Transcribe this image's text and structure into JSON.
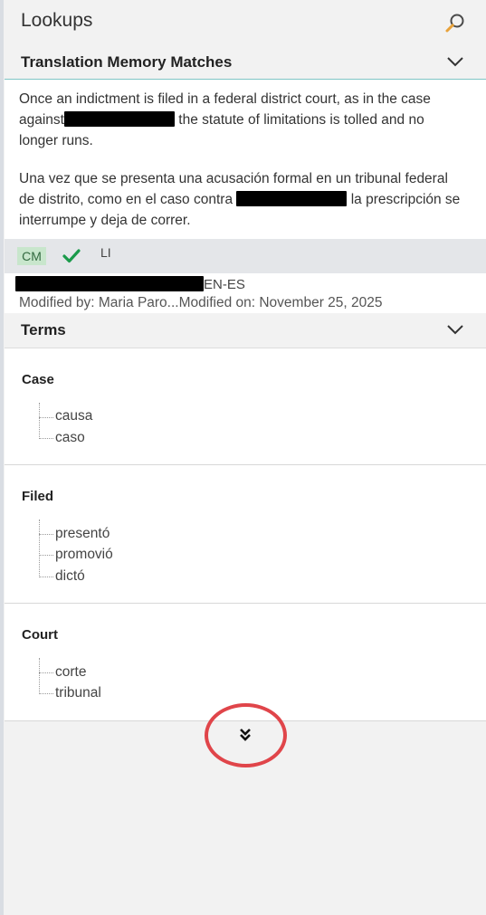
{
  "panel": {
    "title": "Lookups",
    "search_icon": "search-icon"
  },
  "tm": {
    "title": "Translation Memory Matches",
    "source_before": "Once an indictment is filed in a federal district court, as in the case against",
    "source_after": " the statute of limitations is tolled and no longer runs.",
    "target_before": "Una vez que se presenta una acusación formal en un tribunal federal de distrito, como en el caso contra",
    "target_after": " la prescripción se interrumpe y deja de correr.",
    "badge": "CM",
    "li_label": "LI",
    "lang_pair": "EN-ES",
    "modified_by": "Modified by: Maria Paro...",
    "modified_on": "Modified on: November 25, 2025"
  },
  "terms": {
    "title": "Terms",
    "groups": [
      {
        "head": "Case",
        "items": [
          "causa",
          "caso"
        ]
      },
      {
        "head": "Filed",
        "items": [
          "presentó",
          "promovió",
          "dictó"
        ]
      },
      {
        "head": "Court",
        "items": [
          "corte",
          "tribunal"
        ]
      }
    ]
  },
  "colors": {
    "accent_teal": "#7fc6c6",
    "check_green": "#1a9a4a",
    "annotation_red": "#e0454a",
    "badge_bg": "#c8e6cc"
  }
}
